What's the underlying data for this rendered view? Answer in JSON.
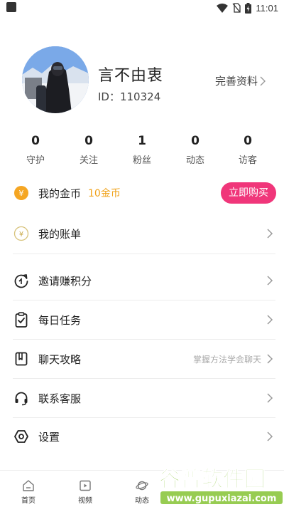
{
  "status_bar": {
    "time": "11:01",
    "icons": [
      "wifi-icon",
      "no-sim-icon",
      "battery-icon"
    ]
  },
  "profile": {
    "name": "言不由衷",
    "id_text": "ID：110324",
    "edit_label": "完善资料"
  },
  "stats": [
    {
      "value": "0",
      "label": "守护"
    },
    {
      "value": "0",
      "label": "关注"
    },
    {
      "value": "1",
      "label": "粉丝"
    },
    {
      "value": "0",
      "label": "动态"
    },
    {
      "value": "0",
      "label": "访客"
    }
  ],
  "coins": {
    "label": "我的金币",
    "amount": "10金币",
    "buy_label": "立即购买",
    "amount_color": "#f0a21a",
    "buy_color": "#f0367a"
  },
  "menu": {
    "bill": "我的账单",
    "invite": "邀请赚积分",
    "daily_task": "每日任务",
    "chat_guide": "聊天攻略",
    "chat_guide_hint": "掌握方法学会聊天",
    "support": "联系客服",
    "settings": "设置"
  },
  "bottom_nav": [
    {
      "label": "首页",
      "icon": "home-icon"
    },
    {
      "label": "视频",
      "icon": "video-icon"
    },
    {
      "label": "动态",
      "icon": "planet-icon"
    }
  ],
  "watermark": {
    "title": "谷普软件园",
    "url": "www.gupuxiazai.com"
  }
}
